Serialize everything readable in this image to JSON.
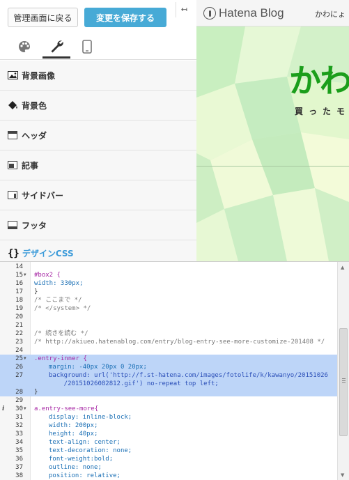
{
  "toolbar": {
    "back_label": "管理画面に戻る",
    "save_label": "変更を保存する",
    "collapse_glyph": "↤"
  },
  "tabs": [
    {
      "name": "design",
      "icon": "palette-icon"
    },
    {
      "name": "customize",
      "icon": "wrench-icon",
      "active": true
    },
    {
      "name": "smartphone",
      "icon": "smartphone-icon"
    }
  ],
  "menu": [
    {
      "label": "背景画像",
      "icon": "image-icon"
    },
    {
      "label": "背景色",
      "icon": "paint-bucket-icon"
    },
    {
      "label": "ヘッダ",
      "icon": "layout-header-icon"
    },
    {
      "label": "記事",
      "icon": "layout-article-icon"
    },
    {
      "label": "サイドバー",
      "icon": "layout-sidebar-icon"
    },
    {
      "label": "フッタ",
      "icon": "layout-footer-icon"
    },
    {
      "label": "デザインCSS",
      "icon": "braces-icon",
      "brace": "{}"
    }
  ],
  "preview": {
    "logo_text": "Hatena Blog",
    "user_text": "かわにょ",
    "blog_title": "かわ",
    "blog_subtitle": "買ったモ"
  },
  "colors": {
    "save_button": "#47aad6",
    "title_green": "#1b9e1b",
    "css_link": "#3a9ad9",
    "highlight": "#bdd5f8"
  },
  "editor": {
    "lines": [
      {
        "n": "14",
        "text": ""
      },
      {
        "n": "15",
        "fold": true,
        "text": "#box2 {",
        "cls": "t-sel"
      },
      {
        "n": "16",
        "text": "width: 330px;",
        "cls": "t-prop"
      },
      {
        "n": "17",
        "text": "}",
        "cls": "t-punc"
      },
      {
        "n": "18",
        "text": "/* ここまで */",
        "cls": "t-cmt"
      },
      {
        "n": "19",
        "text": "/* </system> */",
        "cls": "t-cmt"
      },
      {
        "n": "20",
        "text": ""
      },
      {
        "n": "21",
        "text": ""
      },
      {
        "n": "22",
        "text": "/* 続きを読む */",
        "cls": "t-cmt"
      },
      {
        "n": "23",
        "text": "/* http://akiueo.hatenablog.com/entry/blog-entry-see-more-customize-201408 */",
        "cls": "t-cmt"
      },
      {
        "n": "24",
        "text": ""
      },
      {
        "n": "25",
        "fold": true,
        "hl": true,
        "text": ".entry-inner {",
        "cls": "t-sel"
      },
      {
        "n": "26",
        "hl": true,
        "indent": true,
        "text": "margin: -40px 20px 0 20px;",
        "cls": "t-prop"
      },
      {
        "n": "27",
        "hl": true,
        "indent": true,
        "text": "background: url('http://f.st-hatena.com/images/fotolife/k/kawanyo/20151026",
        "cls": "t-str"
      },
      {
        "n": "",
        "hl": true,
        "indent": true,
        "text": "    /20151026082812.gif') no-repeat top left;",
        "cls": "t-str"
      },
      {
        "n": "28",
        "hl": true,
        "text": "}",
        "cls": "t-punc"
      },
      {
        "n": "29",
        "text": ""
      },
      {
        "n": "30",
        "fold": true,
        "info": "i",
        "text": "a.entry-see-more{",
        "cls": "t-sel"
      },
      {
        "n": "31",
        "indent": true,
        "text": "display: inline-block;",
        "cls": "t-prop"
      },
      {
        "n": "32",
        "indent": true,
        "text": "width: 200px;",
        "cls": "t-prop"
      },
      {
        "n": "33",
        "indent": true,
        "text": "height: 40px;",
        "cls": "t-prop"
      },
      {
        "n": "34",
        "indent": true,
        "text": "text-align: center;",
        "cls": "t-prop"
      },
      {
        "n": "35",
        "indent": true,
        "text": "text-decoration: none;",
        "cls": "t-prop"
      },
      {
        "n": "36",
        "indent": true,
        "text": "font-weight:bold;",
        "cls": "t-prop"
      },
      {
        "n": "37",
        "indent": true,
        "text": "outline: none;",
        "cls": "t-prop"
      },
      {
        "n": "38",
        "indent": true,
        "text": "position: relative;",
        "cls": "t-prop"
      }
    ]
  }
}
